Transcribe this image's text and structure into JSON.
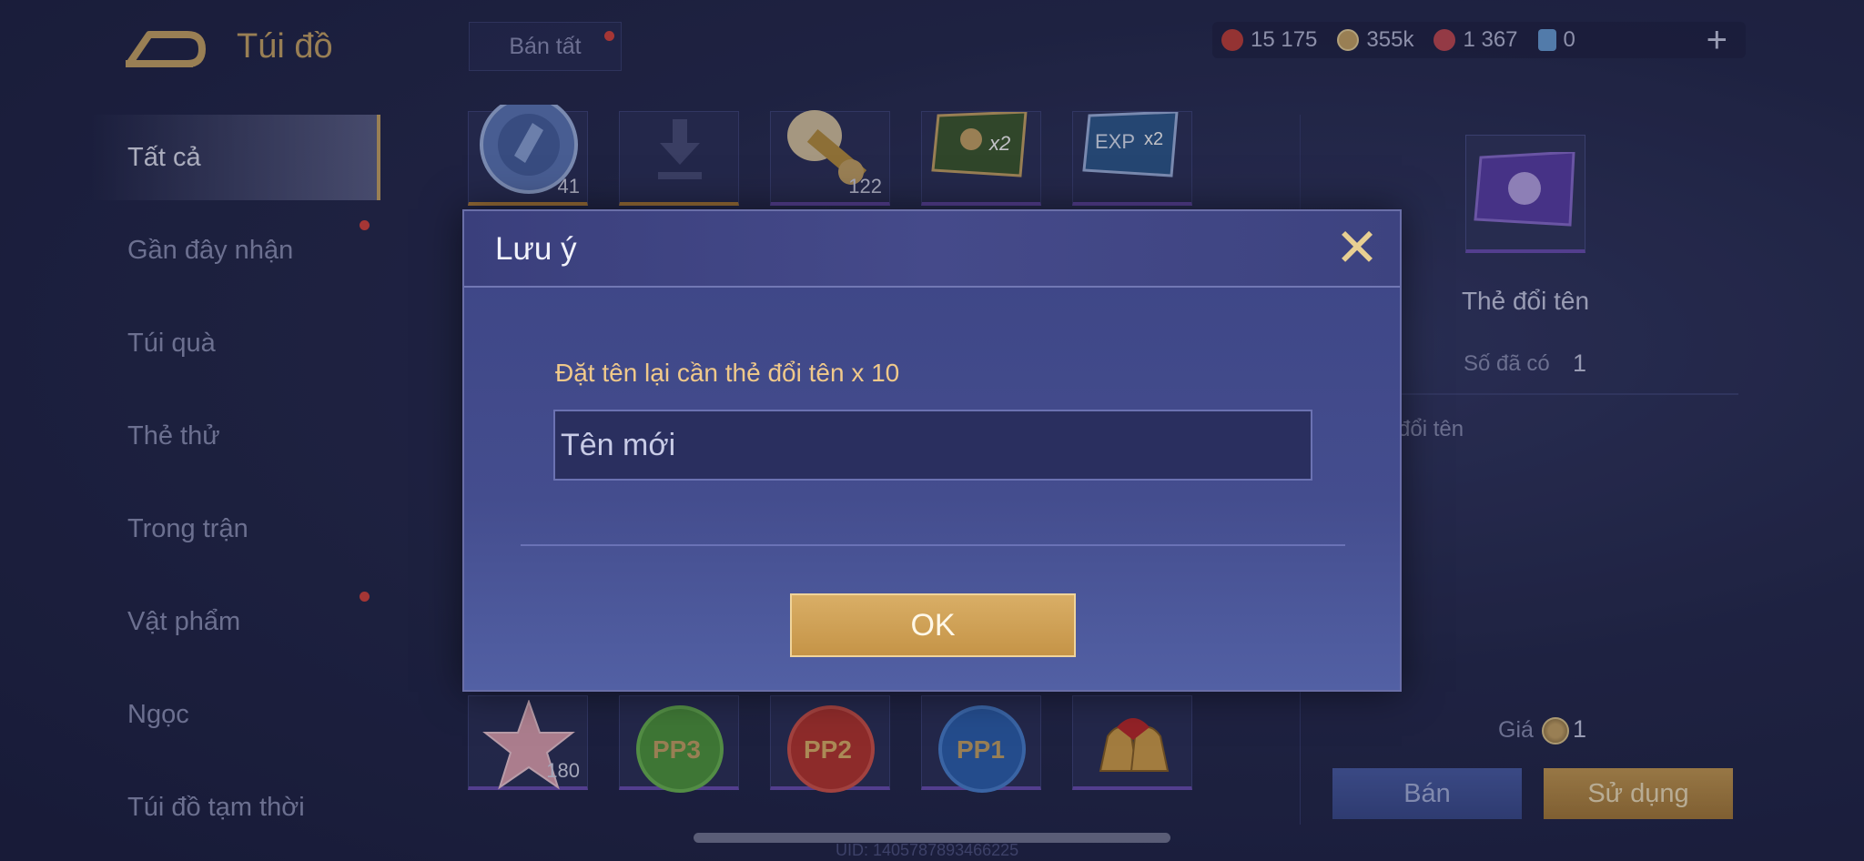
{
  "header": {
    "title": "Túi đồ",
    "sell_all_label": "Bán tất"
  },
  "currencies": [
    {
      "icon": "red-crystal-icon",
      "value": "15 175",
      "color": "#c2413a"
    },
    {
      "icon": "gold-coin-icon",
      "value": "355k",
      "color": "#c9a666"
    },
    {
      "icon": "red-gem-icon",
      "value": "1 367",
      "color": "#c24a52"
    },
    {
      "icon": "blue-card-icon",
      "value": "0",
      "color": "#6aa0d8"
    }
  ],
  "add_label": "+",
  "sidebar": {
    "items": [
      {
        "label": "Tất cả",
        "active": true,
        "dot": false
      },
      {
        "label": "Gần đây nhận",
        "active": false,
        "dot": true
      },
      {
        "label": "Túi quà",
        "active": false,
        "dot": false
      },
      {
        "label": "Thẻ thử",
        "active": false,
        "dot": false
      },
      {
        "label": "Trong trận",
        "active": false,
        "dot": false
      },
      {
        "label": "Vật phẩm",
        "active": false,
        "dot": true
      },
      {
        "label": "Ngọc",
        "active": false,
        "dot": false
      },
      {
        "label": "Túi đồ tạm thời",
        "active": false,
        "dot": false
      }
    ]
  },
  "grid": {
    "row1": [
      {
        "icon": "blue-emblem-icon",
        "count": "41"
      },
      {
        "icon": "download-icon",
        "count": ""
      },
      {
        "icon": "armored-knight-icon",
        "count": "122"
      },
      {
        "icon": "gold-x2-card-icon",
        "count": ""
      },
      {
        "icon": "exp-x2-card-icon",
        "count": ""
      }
    ],
    "row2": [
      {
        "icon": "pink-star-icon",
        "count": "180"
      },
      {
        "icon": "pp3-token-icon",
        "count": ""
      },
      {
        "icon": "pp2-token-icon",
        "count": ""
      },
      {
        "icon": "pp1-token-icon",
        "count": ""
      },
      {
        "icon": "bells-icon",
        "count": ""
      }
    ]
  },
  "detail": {
    "name": "Thẻ đổi tên",
    "owned_label": "Số đã có",
    "owned_value": "1",
    "description": "đổi tên",
    "price_label": "Giá",
    "price_value": "1",
    "sell_label": "Bán",
    "use_label": "Sử dụng"
  },
  "uid": "UID: 1405787893466225",
  "modal": {
    "title": "Lưu ý",
    "message": "Đặt tên lại cần thẻ đổi tên x 10",
    "input_placeholder": "Tên mới",
    "ok_label": "OK"
  }
}
